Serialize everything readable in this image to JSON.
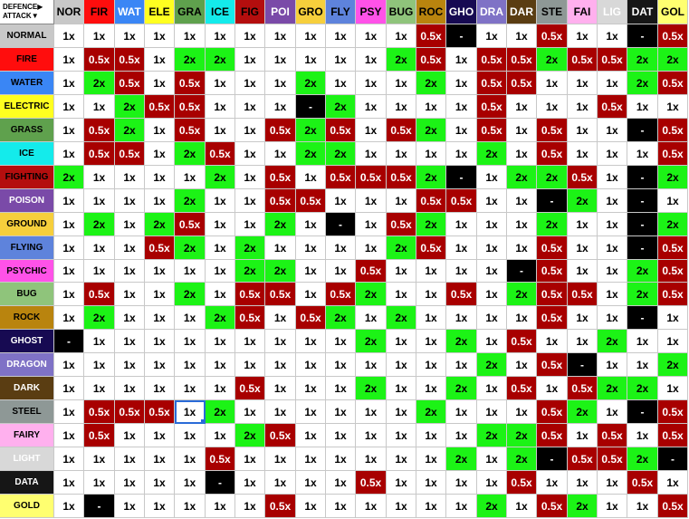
{
  "header": {
    "defence_label": "DEFENCE▶",
    "attack_label": "ATTACK▼"
  },
  "columns": [
    {
      "label": "NOR",
      "bg": "#c8c8c8",
      "fg": "#000000"
    },
    {
      "label": "FIR",
      "bg": "#ff0d0d",
      "fg": "#000000"
    },
    {
      "label": "WAT",
      "bg": "#3a86f5",
      "fg": "#ffffff"
    },
    {
      "label": "ELE",
      "bg": "#ffff20",
      "fg": "#000000"
    },
    {
      "label": "GRA",
      "bg": "#5fa14d",
      "fg": "#000000"
    },
    {
      "label": "ICE",
      "bg": "#14ebeb",
      "fg": "#000000"
    },
    {
      "label": "FIG",
      "bg": "#b40e0e",
      "fg": "#000000"
    },
    {
      "label": "POI",
      "bg": "#7a4aa8",
      "fg": "#ffffff"
    },
    {
      "label": "GRO",
      "bg": "#f6cf3c",
      "fg": "#000000"
    },
    {
      "label": "FLY",
      "bg": "#5e83dc",
      "fg": "#000000"
    },
    {
      "label": "PSY",
      "bg": "#ff52e8",
      "fg": "#000000"
    },
    {
      "label": "BUG",
      "bg": "#8fc47b",
      "fg": "#000000"
    },
    {
      "label": "ROC",
      "bg": "#b9840e",
      "fg": "#000000"
    },
    {
      "label": "GHO",
      "bg": "#170a52",
      "fg": "#ffffff"
    },
    {
      "label": "DRA",
      "bg": "#7f72c6",
      "fg": "#ffffff"
    },
    {
      "label": "DAR",
      "bg": "#5a3d12",
      "fg": "#ffffff"
    },
    {
      "label": "STE",
      "bg": "#8e9896",
      "fg": "#000000"
    },
    {
      "label": "FAI",
      "bg": "#ffb0ee",
      "fg": "#000000"
    },
    {
      "label": "LIG",
      "bg": "#d8d8d8",
      "fg": "#ffffff"
    },
    {
      "label": "DAT",
      "bg": "#161616",
      "fg": "#ffffff"
    },
    {
      "label": "GOL",
      "bg": "#ffff70",
      "fg": "#000000"
    }
  ],
  "rows": [
    {
      "label": "NORMAL",
      "bg": "#c8c8c8",
      "fg": "#000000",
      "values": [
        "1x",
        "1x",
        "1x",
        "1x",
        "1x",
        "1x",
        "1x",
        "1x",
        "1x",
        "1x",
        "1x",
        "1x",
        "0.5x",
        "-",
        "1x",
        "1x",
        "0.5x",
        "1x",
        "1x",
        "-",
        "0.5x"
      ]
    },
    {
      "label": "FIRE",
      "bg": "#ff0d0d",
      "fg": "#000000",
      "values": [
        "1x",
        "0.5x",
        "0.5x",
        "1x",
        "2x",
        "2x",
        "1x",
        "1x",
        "1x",
        "1x",
        "1x",
        "2x",
        "0.5x",
        "1x",
        "0.5x",
        "0.5x",
        "2x",
        "0.5x",
        "0.5x",
        "2x",
        "2x"
      ]
    },
    {
      "label": "WATER",
      "bg": "#3a86f5",
      "fg": "#000000",
      "values": [
        "1x",
        "2x",
        "0.5x",
        "1x",
        "0.5x",
        "1x",
        "1x",
        "1x",
        "2x",
        "1x",
        "1x",
        "1x",
        "2x",
        "1x",
        "0.5x",
        "0.5x",
        "1x",
        "1x",
        "1x",
        "2x",
        "0.5x"
      ]
    },
    {
      "label": "ELECTRIC",
      "bg": "#ffff20",
      "fg": "#000000",
      "values": [
        "1x",
        "1x",
        "2x",
        "0.5x",
        "0.5x",
        "1x",
        "1x",
        "1x",
        "-",
        "2x",
        "1x",
        "1x",
        "1x",
        "1x",
        "0.5x",
        "1x",
        "1x",
        "1x",
        "0.5x",
        "1x",
        "1x"
      ]
    },
    {
      "label": "GRASS",
      "bg": "#5fa14d",
      "fg": "#000000",
      "values": [
        "1x",
        "0.5x",
        "2x",
        "1x",
        "0.5x",
        "1x",
        "1x",
        "0.5x",
        "2x",
        "0.5x",
        "1x",
        "0.5x",
        "2x",
        "1x",
        "0.5x",
        "1x",
        "0.5x",
        "1x",
        "1x",
        "-",
        "0.5x"
      ]
    },
    {
      "label": "ICE",
      "bg": "#14ebeb",
      "fg": "#000000",
      "values": [
        "1x",
        "0.5x",
        "0.5x",
        "1x",
        "2x",
        "0.5x",
        "1x",
        "1x",
        "2x",
        "2x",
        "1x",
        "1x",
        "1x",
        "1x",
        "2x",
        "1x",
        "0.5x",
        "1x",
        "1x",
        "1x",
        "0.5x"
      ]
    },
    {
      "label": "FIGHTING",
      "bg": "#b40e0e",
      "fg": "#000000",
      "values": [
        "2x",
        "1x",
        "1x",
        "1x",
        "1x",
        "2x",
        "1x",
        "0.5x",
        "1x",
        "0.5x",
        "0.5x",
        "0.5x",
        "2x",
        "-",
        "1x",
        "2x",
        "2x",
        "0.5x",
        "1x",
        "-",
        "2x"
      ]
    },
    {
      "label": "POISON",
      "bg": "#7a4aa8",
      "fg": "#ffffff",
      "values": [
        "1x",
        "1x",
        "1x",
        "1x",
        "2x",
        "1x",
        "1x",
        "0.5x",
        "0.5x",
        "1x",
        "1x",
        "1x",
        "0.5x",
        "0.5x",
        "1x",
        "1x",
        "-",
        "2x",
        "1x",
        "-",
        "1x"
      ]
    },
    {
      "label": "GROUND",
      "bg": "#f6cf3c",
      "fg": "#000000",
      "values": [
        "1x",
        "2x",
        "1x",
        "2x",
        "0.5x",
        "1x",
        "1x",
        "2x",
        "1x",
        "-",
        "1x",
        "0.5x",
        "2x",
        "1x",
        "1x",
        "1x",
        "2x",
        "1x",
        "1x",
        "-",
        "2x"
      ]
    },
    {
      "label": "FLYING",
      "bg": "#5e83dc",
      "fg": "#000000",
      "values": [
        "1x",
        "1x",
        "1x",
        "0.5x",
        "2x",
        "1x",
        "2x",
        "1x",
        "1x",
        "1x",
        "1x",
        "2x",
        "0.5x",
        "1x",
        "1x",
        "1x",
        "0.5x",
        "1x",
        "1x",
        "-",
        "0.5x"
      ]
    },
    {
      "label": "PSYCHIC",
      "bg": "#ff52e8",
      "fg": "#000000",
      "values": [
        "1x",
        "1x",
        "1x",
        "1x",
        "1x",
        "1x",
        "2x",
        "2x",
        "1x",
        "1x",
        "0.5x",
        "1x",
        "1x",
        "1x",
        "1x",
        "-",
        "0.5x",
        "1x",
        "1x",
        "2x",
        "0.5x"
      ]
    },
    {
      "label": "BUG",
      "bg": "#8fc47b",
      "fg": "#000000",
      "values": [
        "1x",
        "0.5x",
        "1x",
        "1x",
        "2x",
        "1x",
        "0.5x",
        "0.5x",
        "1x",
        "0.5x",
        "2x",
        "1x",
        "1x",
        "0.5x",
        "1x",
        "2x",
        "0.5x",
        "0.5x",
        "1x",
        "2x",
        "0.5x"
      ]
    },
    {
      "label": "ROCK",
      "bg": "#b9840e",
      "fg": "#000000",
      "values": [
        "1x",
        "2x",
        "1x",
        "1x",
        "1x",
        "2x",
        "0.5x",
        "1x",
        "0.5x",
        "2x",
        "1x",
        "2x",
        "1x",
        "1x",
        "1x",
        "1x",
        "0.5x",
        "1x",
        "1x",
        "-",
        "1x"
      ]
    },
    {
      "label": "GHOST",
      "bg": "#170a52",
      "fg": "#ffffff",
      "values": [
        "-",
        "1x",
        "1x",
        "1x",
        "1x",
        "1x",
        "1x",
        "1x",
        "1x",
        "1x",
        "2x",
        "1x",
        "1x",
        "2x",
        "1x",
        "0.5x",
        "1x",
        "1x",
        "2x",
        "1x",
        "1x"
      ]
    },
    {
      "label": "DRAGON",
      "bg": "#7f72c6",
      "fg": "#ffffff",
      "values": [
        "1x",
        "1x",
        "1x",
        "1x",
        "1x",
        "1x",
        "1x",
        "1x",
        "1x",
        "1x",
        "1x",
        "1x",
        "1x",
        "1x",
        "2x",
        "1x",
        "0.5x",
        "-",
        "1x",
        "1x",
        "2x"
      ]
    },
    {
      "label": "DARK",
      "bg": "#5a3d12",
      "fg": "#ffffff",
      "values": [
        "1x",
        "1x",
        "1x",
        "1x",
        "1x",
        "1x",
        "0.5x",
        "1x",
        "1x",
        "1x",
        "2x",
        "1x",
        "1x",
        "2x",
        "1x",
        "0.5x",
        "1x",
        "0.5x",
        "2x",
        "2x",
        "1x"
      ]
    },
    {
      "label": "STEEL",
      "bg": "#8e9896",
      "fg": "#000000",
      "values": [
        "1x",
        "0.5x",
        "0.5x",
        "0.5x",
        "1x",
        "2x",
        "1x",
        "1x",
        "1x",
        "1x",
        "1x",
        "1x",
        "2x",
        "1x",
        "1x",
        "1x",
        "0.5x",
        "2x",
        "1x",
        "-",
        "0.5x"
      ]
    },
    {
      "label": "FAIRY",
      "bg": "#ffb0ee",
      "fg": "#000000",
      "values": [
        "1x",
        "0.5x",
        "1x",
        "1x",
        "1x",
        "1x",
        "2x",
        "0.5x",
        "1x",
        "1x",
        "1x",
        "1x",
        "1x",
        "1x",
        "2x",
        "2x",
        "0.5x",
        "1x",
        "0.5x",
        "1x",
        "0.5x"
      ]
    },
    {
      "label": "LIGHT",
      "bg": "#d8d8d8",
      "fg": "#ffffff",
      "values": [
        "1x",
        "1x",
        "1x",
        "1x",
        "1x",
        "0.5x",
        "1x",
        "1x",
        "1x",
        "1x",
        "1x",
        "1x",
        "1x",
        "2x",
        "1x",
        "2x",
        "-",
        "0.5x",
        "0.5x",
        "2x",
        "-"
      ]
    },
    {
      "label": "DATA",
      "bg": "#161616",
      "fg": "#ffffff",
      "values": [
        "1x",
        "1x",
        "1x",
        "1x",
        "1x",
        "-",
        "1x",
        "1x",
        "1x",
        "1x",
        "0.5x",
        "1x",
        "1x",
        "1x",
        "1x",
        "0.5x",
        "1x",
        "1x",
        "1x",
        "0.5x",
        "1x"
      ]
    },
    {
      "label": "GOLD",
      "bg": "#ffff70",
      "fg": "#000000",
      "values": [
        "1x",
        "-",
        "1x",
        "1x",
        "1x",
        "1x",
        "1x",
        "0.5x",
        "1x",
        "1x",
        "1x",
        "1x",
        "1x",
        "1x",
        "2x",
        "1x",
        "0.5x",
        "2x",
        "1x",
        "1x",
        "0.5x"
      ]
    }
  ],
  "selected_cell": {
    "row_label": "STEEL",
    "column_label": "GRA",
    "value": "1x"
  }
}
